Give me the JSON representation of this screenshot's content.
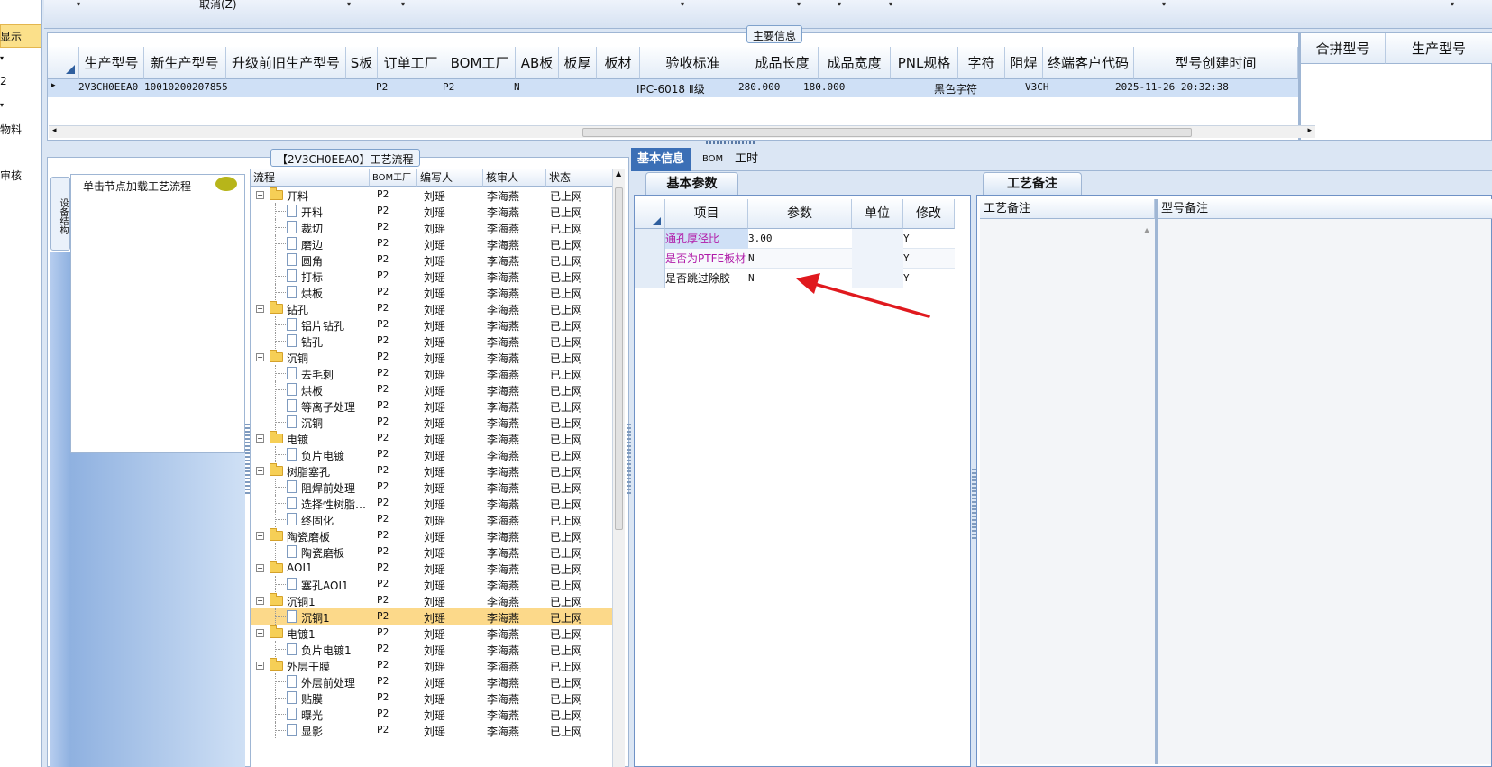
{
  "left_nav": {
    "items": [
      "显示",
      "2",
      "物料",
      "审核"
    ]
  },
  "toolbar": {
    "cancel_label": "取消(Z)"
  },
  "main_info": {
    "caption": "主要信息",
    "columns": [
      "生产型号",
      "新生产型号",
      "升级前旧生产型号",
      "S板",
      "订单工厂",
      "BOM工厂",
      "AB板",
      "板厚",
      "板材",
      "验收标准",
      "成品长度",
      "成品宽度",
      "PNL规格",
      "字符",
      "阻焊",
      "终端客户代码",
      "型号创建时间"
    ],
    "row": {
      "prod_no": "2V3CH0EEA0",
      "new_prod_no": "10010200207855",
      "old_prod_no": "",
      "s_board": "",
      "order_factory": "P2",
      "bom_factory": "P2",
      "ab_board": "N",
      "thickness": "",
      "material": "",
      "standard": "IPC-6018 Ⅱ级",
      "length": "280.000",
      "width": "180.000",
      "pnl": "",
      "char": "黑色字符",
      "solder": "",
      "customer_code": "V3CH",
      "created": "2025-11-26 20:32:38"
    },
    "side_columns": [
      "合拼型号",
      "生产型号"
    ]
  },
  "flow": {
    "caption": "【2V3CH0EEA0】工艺流程",
    "side_tab_label": "设备结构",
    "load_hint": "单击节点加载工艺流程",
    "columns": [
      "流程",
      "BOM工厂",
      "编写人",
      "核审人",
      "状态"
    ],
    "rows": [
      {
        "name": "开料",
        "level": 0,
        "factory": "P2",
        "writer": "刘瑶",
        "reviewer": "李海燕",
        "status": "已上网"
      },
      {
        "name": "开料",
        "level": 1,
        "factory": "P2",
        "writer": "刘瑶",
        "reviewer": "李海燕",
        "status": "已上网"
      },
      {
        "name": "裁切",
        "level": 1,
        "factory": "P2",
        "writer": "刘瑶",
        "reviewer": "李海燕",
        "status": "已上网"
      },
      {
        "name": "磨边",
        "level": 1,
        "factory": "P2",
        "writer": "刘瑶",
        "reviewer": "李海燕",
        "status": "已上网"
      },
      {
        "name": "圆角",
        "level": 1,
        "factory": "P2",
        "writer": "刘瑶",
        "reviewer": "李海燕",
        "status": "已上网"
      },
      {
        "name": "打标",
        "level": 1,
        "factory": "P2",
        "writer": "刘瑶",
        "reviewer": "李海燕",
        "status": "已上网"
      },
      {
        "name": "烘板",
        "level": 1,
        "factory": "P2",
        "writer": "刘瑶",
        "reviewer": "李海燕",
        "status": "已上网"
      },
      {
        "name": "钻孔",
        "level": 0,
        "factory": "P2",
        "writer": "刘瑶",
        "reviewer": "李海燕",
        "status": "已上网"
      },
      {
        "name": "铝片钻孔",
        "level": 1,
        "factory": "P2",
        "writer": "刘瑶",
        "reviewer": "李海燕",
        "status": "已上网"
      },
      {
        "name": "钻孔",
        "level": 1,
        "factory": "P2",
        "writer": "刘瑶",
        "reviewer": "李海燕",
        "status": "已上网"
      },
      {
        "name": "沉铜",
        "level": 0,
        "factory": "P2",
        "writer": "刘瑶",
        "reviewer": "李海燕",
        "status": "已上网"
      },
      {
        "name": "去毛刺",
        "level": 1,
        "factory": "P2",
        "writer": "刘瑶",
        "reviewer": "李海燕",
        "status": "已上网"
      },
      {
        "name": "烘板",
        "level": 1,
        "factory": "P2",
        "writer": "刘瑶",
        "reviewer": "李海燕",
        "status": "已上网"
      },
      {
        "name": "等离子处理",
        "level": 1,
        "factory": "P2",
        "writer": "刘瑶",
        "reviewer": "李海燕",
        "status": "已上网"
      },
      {
        "name": "沉铜",
        "level": 1,
        "factory": "P2",
        "writer": "刘瑶",
        "reviewer": "李海燕",
        "status": "已上网"
      },
      {
        "name": "电镀",
        "level": 0,
        "factory": "P2",
        "writer": "刘瑶",
        "reviewer": "李海燕",
        "status": "已上网"
      },
      {
        "name": "负片电镀",
        "level": 1,
        "factory": "P2",
        "writer": "刘瑶",
        "reviewer": "李海燕",
        "status": "已上网"
      },
      {
        "name": "树脂塞孔",
        "level": 0,
        "factory": "P2",
        "writer": "刘瑶",
        "reviewer": "李海燕",
        "status": "已上网"
      },
      {
        "name": "阻焊前处理",
        "level": 1,
        "factory": "P2",
        "writer": "刘瑶",
        "reviewer": "李海燕",
        "status": "已上网"
      },
      {
        "name": "选择性树脂…",
        "level": 1,
        "factory": "P2",
        "writer": "刘瑶",
        "reviewer": "李海燕",
        "status": "已上网"
      },
      {
        "name": "终固化",
        "level": 1,
        "factory": "P2",
        "writer": "刘瑶",
        "reviewer": "李海燕",
        "status": "已上网"
      },
      {
        "name": "陶瓷磨板",
        "level": 0,
        "factory": "P2",
        "writer": "刘瑶",
        "reviewer": "李海燕",
        "status": "已上网"
      },
      {
        "name": "陶瓷磨板",
        "level": 1,
        "factory": "P2",
        "writer": "刘瑶",
        "reviewer": "李海燕",
        "status": "已上网"
      },
      {
        "name": "AOI1",
        "level": 0,
        "factory": "P2",
        "writer": "刘瑶",
        "reviewer": "李海燕",
        "status": "已上网"
      },
      {
        "name": "塞孔AOI1",
        "level": 1,
        "factory": "P2",
        "writer": "刘瑶",
        "reviewer": "李海燕",
        "status": "已上网"
      },
      {
        "name": "沉铜1",
        "level": 0,
        "factory": "P2",
        "writer": "刘瑶",
        "reviewer": "李海燕",
        "status": "已上网"
      },
      {
        "name": "沉铜1",
        "level": 1,
        "factory": "P2",
        "writer": "刘瑶",
        "reviewer": "李海燕",
        "status": "已上网",
        "selected": true
      },
      {
        "name": "电镀1",
        "level": 0,
        "factory": "P2",
        "writer": "刘瑶",
        "reviewer": "李海燕",
        "status": "已上网"
      },
      {
        "name": "负片电镀1",
        "level": 1,
        "factory": "P2",
        "writer": "刘瑶",
        "reviewer": "李海燕",
        "status": "已上网"
      },
      {
        "name": "外层干膜",
        "level": 0,
        "factory": "P2",
        "writer": "刘瑶",
        "reviewer": "李海燕",
        "status": "已上网"
      },
      {
        "name": "外层前处理",
        "level": 1,
        "factory": "P2",
        "writer": "刘瑶",
        "reviewer": "李海燕",
        "status": "已上网"
      },
      {
        "name": "贴膜",
        "level": 1,
        "factory": "P2",
        "writer": "刘瑶",
        "reviewer": "李海燕",
        "status": "已上网"
      },
      {
        "name": "曝光",
        "level": 1,
        "factory": "P2",
        "writer": "刘瑶",
        "reviewer": "李海燕",
        "status": "已上网"
      },
      {
        "name": "显影",
        "level": 1,
        "factory": "P2",
        "writer": "刘瑶",
        "reviewer": "李海燕",
        "status": "已上网"
      }
    ]
  },
  "detail_tabs": [
    "基本信息",
    "BOM",
    "工时"
  ],
  "basic": {
    "tab_label": "基本参数",
    "columns": [
      "项目",
      "参数",
      "单位",
      "修改"
    ],
    "rows": [
      {
        "item": "通孔厚径比",
        "value": "3.00",
        "unit": "",
        "edit": "Y"
      },
      {
        "item": "是否为PTFE板材",
        "value": "N",
        "unit": "",
        "edit": "Y"
      },
      {
        "item": "是否跳过除胶",
        "value": "N",
        "unit": "",
        "edit": "Y"
      }
    ]
  },
  "remarks": {
    "tab_label": "工艺备注",
    "columns": [
      "工艺备注",
      "型号备注"
    ]
  },
  "colors": {
    "accent": "#3b6fb6",
    "selected_row": "#fcd98a",
    "arrow": "#e0191e",
    "purple_text": "#b01aa8"
  }
}
